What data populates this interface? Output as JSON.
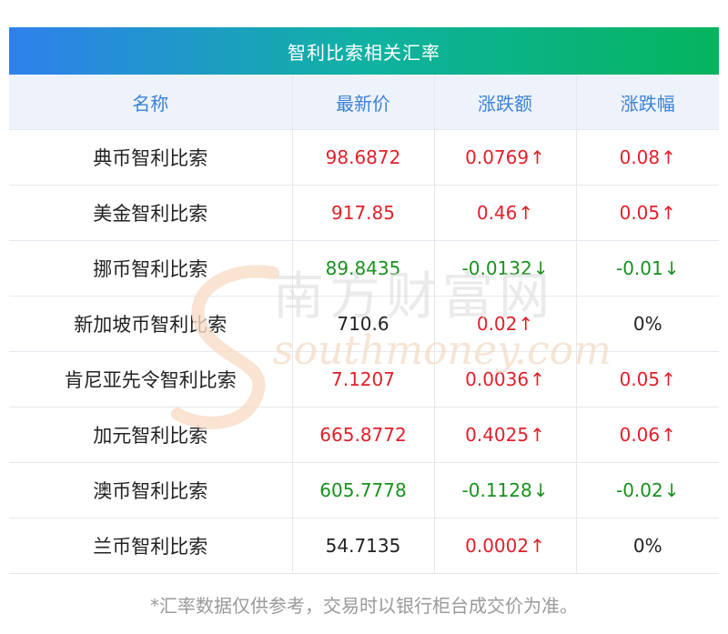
{
  "title": "智利比索相关汇率",
  "headers": [
    "名称",
    "最新价",
    "涨跌额",
    "涨跌幅"
  ],
  "rows": [
    {
      "name": "典币智利比索",
      "price": "98.6872",
      "change": "0.0769",
      "pct": "0.08",
      "dir": "up"
    },
    {
      "name": "美金智利比索",
      "price": "917.85",
      "change": "0.46",
      "pct": "0.05",
      "dir": "up"
    },
    {
      "name": "挪币智利比索",
      "price": "89.8435",
      "change": "-0.0132",
      "pct": "-0.01",
      "dir": "down"
    },
    {
      "name": "新加坡币智利比索",
      "price": "710.6",
      "change": "0.02",
      "pct": "0%",
      "dir": "flat",
      "change_dir": "up"
    },
    {
      "name": "肯尼亚先令智利比索",
      "price": "7.1207",
      "change": "0.0036",
      "pct": "0.05",
      "dir": "up"
    },
    {
      "name": "加元智利比索",
      "price": "665.8772",
      "change": "0.4025",
      "pct": "0.06",
      "dir": "up"
    },
    {
      "name": "澳币智利比索",
      "price": "605.7778",
      "change": "-0.1128",
      "pct": "-0.02",
      "dir": "down"
    },
    {
      "name": "兰币智利比索",
      "price": "54.7135",
      "change": "0.0002",
      "pct": "0%",
      "dir": "flat",
      "change_dir": "up"
    }
  ],
  "arrows": {
    "up": "↑",
    "down": "↓"
  },
  "watermark": {
    "cn": "南方财富网",
    "en": "southmoney.com"
  },
  "footnote": "*汇率数据仅供参考，交易时以银行柜台成交价为准。",
  "colors": {
    "up": "#e0212a",
    "down": "#19911d",
    "header_text": "#3b82d6"
  }
}
